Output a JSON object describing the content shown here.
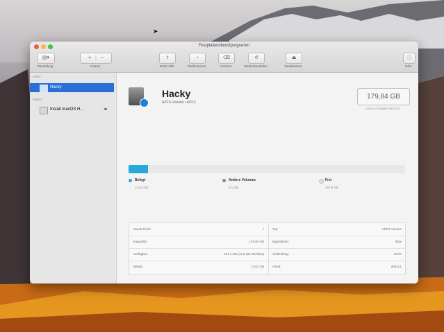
{
  "window": {
    "title": "Festplattendienstprogramm"
  },
  "toolbar": {
    "left_buttons": [
      {
        "label": "Darstellung",
        "icon": "sidebar-icon"
      },
      {
        "label": "Volume",
        "icon": "volume-icon"
      }
    ],
    "buttons": [
      {
        "label": "Erste Hilfe",
        "icon": "stethoscope-icon"
      },
      {
        "label": "Partitionieren",
        "icon": "partition-icon"
      },
      {
        "label": "Löschen",
        "icon": "erase-icon"
      },
      {
        "label": "Wiederherstellen",
        "icon": "restore-icon"
      },
      {
        "label": "Deaktivieren",
        "icon": "unmount-icon"
      }
    ],
    "right_button": {
      "label": "Infos",
      "icon": "info-icon"
    }
  },
  "sidebar": {
    "section_internal": "Intern",
    "section_external": "Extern",
    "items": [
      {
        "label": "Hacky",
        "selected": true,
        "icon": "disk-icon"
      },
      {
        "label": "Install macOS H...",
        "selected": false,
        "icon": "disk-icon",
        "eject_icon": "eject-icon"
      }
    ]
  },
  "volume": {
    "name": "Hacky",
    "subtitle": "APFS-Volume • APFS",
    "size": "179,84 GB",
    "size_sub": "VON 4 VOLUMES GETEILT"
  },
  "usage": {
    "used_fraction": 0.07,
    "fill_color": "#2aa7d9",
    "legend": [
      {
        "title": "Belegt",
        "value": "13,61 GB",
        "color": "#2aa7d9"
      },
      {
        "title": "Andere Volumes",
        "value": "8,1 GB",
        "color": "#8a8a8a"
      },
      {
        "title": "Frei",
        "value": "157,9 GB",
        "color": "#e0e0e0"
      }
    ]
  },
  "info_table": [
    {
      "left_label": "Mount-Point:",
      "left_value": "/",
      "right_label": "Typ:",
      "right_value": "APFS-Volume"
    },
    {
      "left_label": "Kapazität:",
      "left_value": "179,84 GB",
      "right_label": "Eigentümer:",
      "right_value": "Aktiv"
    },
    {
      "left_label": "Verfügbar:",
      "left_value": "167,2 GB (12,6 GB löschbar)",
      "right_label": "Verbindung:",
      "right_value": "SATA"
    },
    {
      "left_label": "Belegt:",
      "left_value": "13,61 GB",
      "right_label": "Gerät:",
      "right_value": "disk1s1"
    }
  ]
}
